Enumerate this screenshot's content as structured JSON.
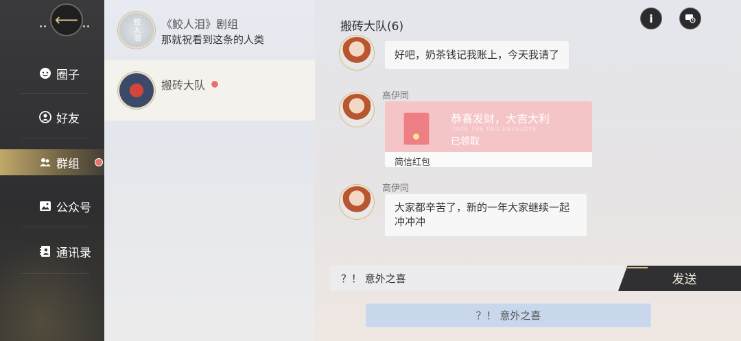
{
  "nav": {
    "items": [
      {
        "label": "圈子",
        "icon": "circle-chat-icon"
      },
      {
        "label": "好友",
        "icon": "friend-icon"
      },
      {
        "label": "群组",
        "icon": "group-icon",
        "active": true,
        "badge": true
      },
      {
        "label": "公众号",
        "icon": "image-icon"
      },
      {
        "label": "通讯录",
        "icon": "contacts-icon"
      }
    ]
  },
  "conversations": [
    {
      "title": "《鲛人泪》剧组",
      "subtitle": "那就祝看到这条的人类",
      "avatar_text": "鲛人泪"
    },
    {
      "title": "搬砖大队",
      "badge": true
    }
  ],
  "chat": {
    "title": "搬砖大队(6)",
    "messages": [
      {
        "sender": "",
        "text": "好吧，奶茶钱记我账上，今天我请了"
      },
      {
        "sender": "高伊同",
        "type": "red-packet",
        "packet_title": "恭喜发财，大吉大利",
        "packet_english": "TAKE THE RED ENVELOPE",
        "packet_status": "已领取",
        "packet_type": "简信红包"
      },
      {
        "sender": "高伊同",
        "text": "大家都辛苦了，新的一年大家继续一起冲冲冲"
      }
    ],
    "input_value": "？！ 意外之喜",
    "send_label": "发送",
    "suggestion": "？！ 意外之喜"
  },
  "colors": {
    "accent_gold": "#d6c08a",
    "badge_red": "#e8726c",
    "packet_pink": "#f5c4c7"
  }
}
